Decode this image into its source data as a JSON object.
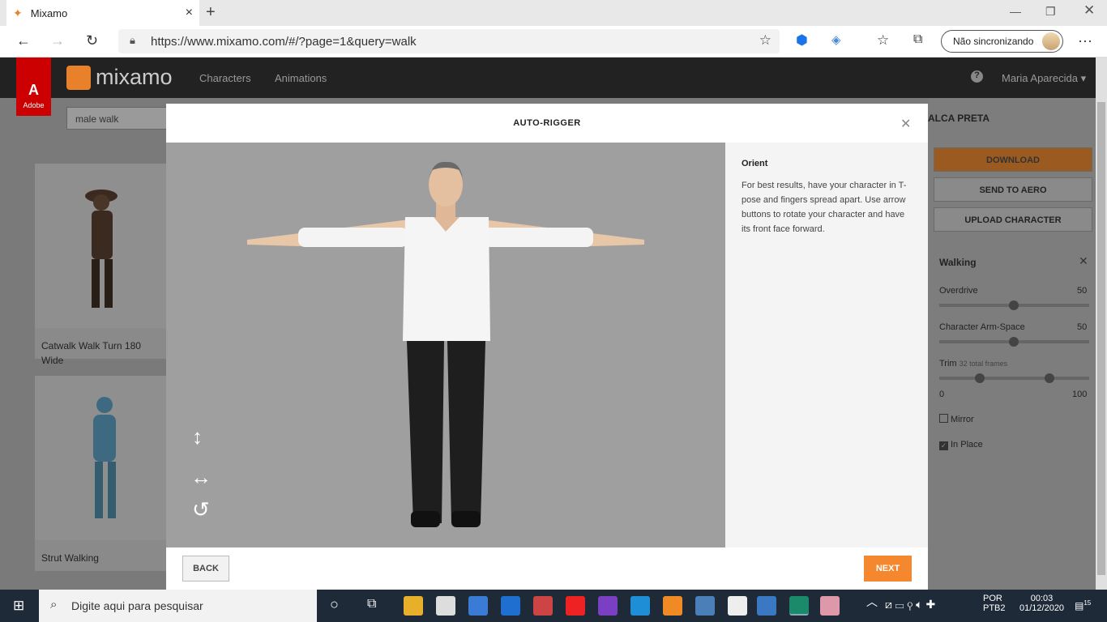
{
  "browser": {
    "tab_title": "Mixamo",
    "url": "https://www.mixamo.com/#/?page=1&query=walk",
    "sync_label": "Não sincronizando"
  },
  "mixamo": {
    "logo_text": "mixamo",
    "adobe_label": "Adobe",
    "nav": [
      "Characters",
      "Animations"
    ],
    "user": "Maria Aparecida",
    "search_value": "male walk",
    "cards": [
      {
        "label": "Catwalk Walk Turn 180 Wide"
      },
      {
        "label": "Strut Walking"
      }
    ],
    "right": {
      "title": "ALCA PRETA",
      "download": "DOWNLOAD",
      "send": "SEND TO AERO",
      "upload": "UPLOAD CHARACTER",
      "anim": "Walking",
      "overdrive_label": "Overdrive",
      "overdrive_val": "50",
      "armspace_label": "Character Arm-Space",
      "armspace_val": "50",
      "trim_label": "Trim",
      "trim_sub": "32 total frames",
      "trim_min": "0",
      "trim_max": "100",
      "mirror": "Mirror",
      "inplace": "In Place"
    }
  },
  "modal": {
    "title": "AUTO-RIGGER",
    "step_title": "Orient",
    "step_text": "For best results, have your character in T-pose and fingers spread apart. Use arrow buttons to rotate your character and have its front face forward.",
    "back": "BACK",
    "next": "NEXT"
  },
  "taskbar": {
    "search_placeholder": "Digite aqui para pesquisar",
    "lang1": "POR",
    "lang2": "PTB2",
    "time": "00:03",
    "date": "01/12/2020",
    "notif": "15"
  },
  "colors": {
    "accent": "#f5882e",
    "taskbar": "#1e2a38"
  }
}
